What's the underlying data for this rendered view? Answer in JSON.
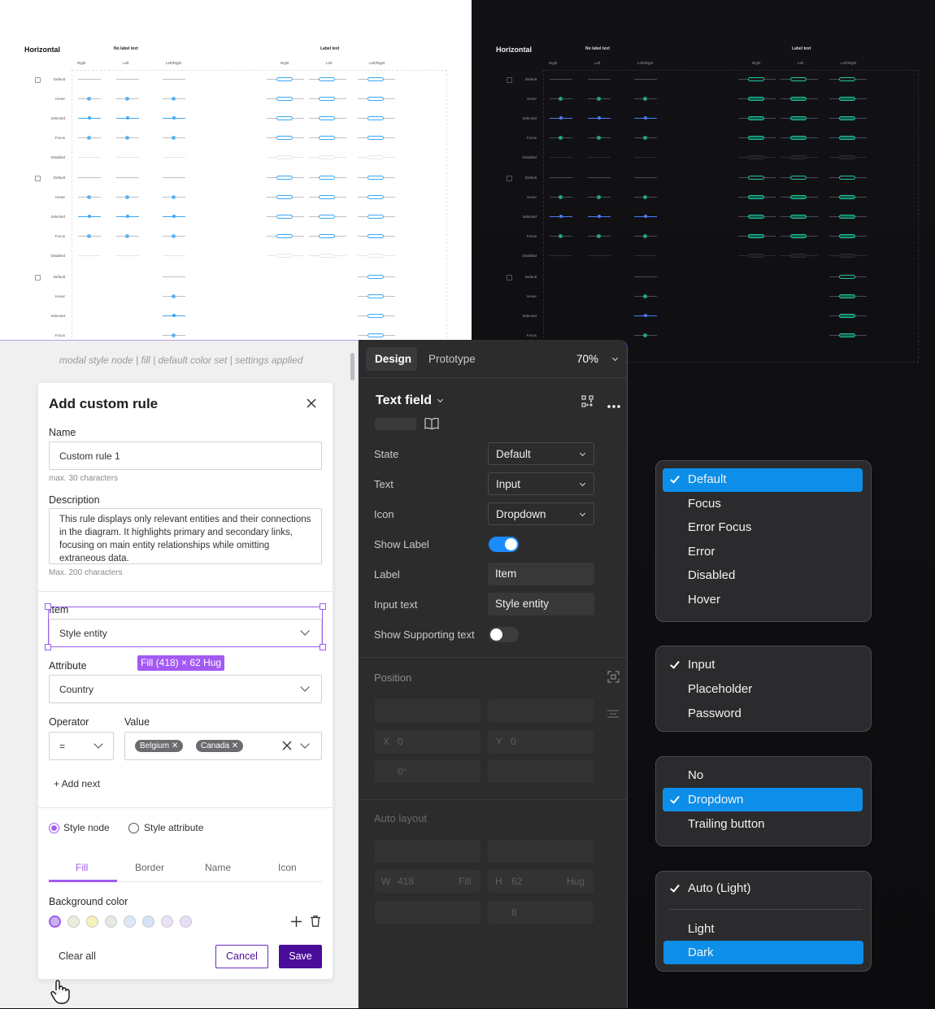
{
  "sheet_light": {
    "title": "Horizontal",
    "no_label": "No label text",
    "label_text": "Label text",
    "cols": [
      "Right",
      "Left",
      "Left/Right"
    ],
    "states": [
      "Default",
      "Hover",
      "Selected",
      "Focus",
      "Disabled"
    ],
    "states3": [
      "Default",
      "Hover",
      "Selected",
      "Focus"
    ]
  },
  "sheet_dark": {
    "title": "Horizontal",
    "no_label": "No label text",
    "label_text": "Label text"
  },
  "breadcrumb": "modal style node | fill | default color set | settings applied",
  "modal": {
    "title": "Add custom rule",
    "name_label": "Name",
    "name_value": "Custom rule 1",
    "name_hint": "max. 30 characters",
    "desc_label": "Description",
    "desc_value": "This rule displays only relevant entities and their connections in the diagram. It highlights primary and secondary links, focusing on main entity relationships while omitting extraneous data.",
    "desc_hint": "Max. 200 characters",
    "item_label": "Item",
    "item_value": "Style entity",
    "size_badge": "Fill (418) × 62 Hug",
    "attr_label": "Attribute",
    "attr_value": "Country",
    "op_label": "Operator",
    "op_value": "=",
    "val_label": "Value",
    "chips": [
      "Belgium",
      "Canada"
    ],
    "add_next": "+ Add next",
    "radio_node": "Style node",
    "radio_attr": "Style attribute",
    "tabs": [
      "Fill",
      "Border",
      "Name",
      "Icon"
    ],
    "bg_label": "Background color",
    "swatches": [
      "#c7b3ee",
      "#ececdc",
      "#f6f1b8",
      "#e6e9e4",
      "#dbe9f6",
      "#d4e3f6",
      "#ebe0f8",
      "#e8dcf7"
    ],
    "clear": "Clear all",
    "cancel": "Cancel",
    "save": "Save"
  },
  "design": {
    "tab_design": "Design",
    "tab_proto": "Prototype",
    "zoom": "70%",
    "component": "Text field",
    "props": [
      {
        "label": "State",
        "value": "Default",
        "type": "select"
      },
      {
        "label": "Text",
        "value": "Input",
        "type": "select"
      },
      {
        "label": "Icon",
        "value": "Dropdown",
        "type": "select"
      },
      {
        "label": "Show Label",
        "value": "",
        "type": "toggle-on"
      },
      {
        "label": "Label",
        "value": "Item",
        "type": "text"
      },
      {
        "label": "Input text",
        "value": "Style entity",
        "type": "text"
      },
      {
        "label": "Show Supporting text",
        "value": "",
        "type": "toggle-off"
      }
    ],
    "position": "Position",
    "x": "X",
    "x_val": "0",
    "y": "Y",
    "y_val": "0",
    "rot": "0°",
    "auto_layout": "Auto layout",
    "w": "W",
    "w_val": "418",
    "w_mode": "Fill",
    "h": "H",
    "h_val": "62",
    "h_mode": "Hug",
    "gap": "8"
  },
  "menus": {
    "state": [
      "Default",
      "Focus",
      "Error Focus",
      "Error",
      "Disabled",
      "Hover"
    ],
    "text": [
      "Input",
      "Placeholder",
      "Password"
    ],
    "icon": [
      "No",
      "Dropdown",
      "Trailing button"
    ],
    "theme": [
      "Auto (Light)",
      "Light",
      "Dark"
    ]
  },
  "colors": {
    "accent": "#0d8ee8",
    "purple": "#4a0d9a",
    "toggle": "#1a8cff"
  }
}
